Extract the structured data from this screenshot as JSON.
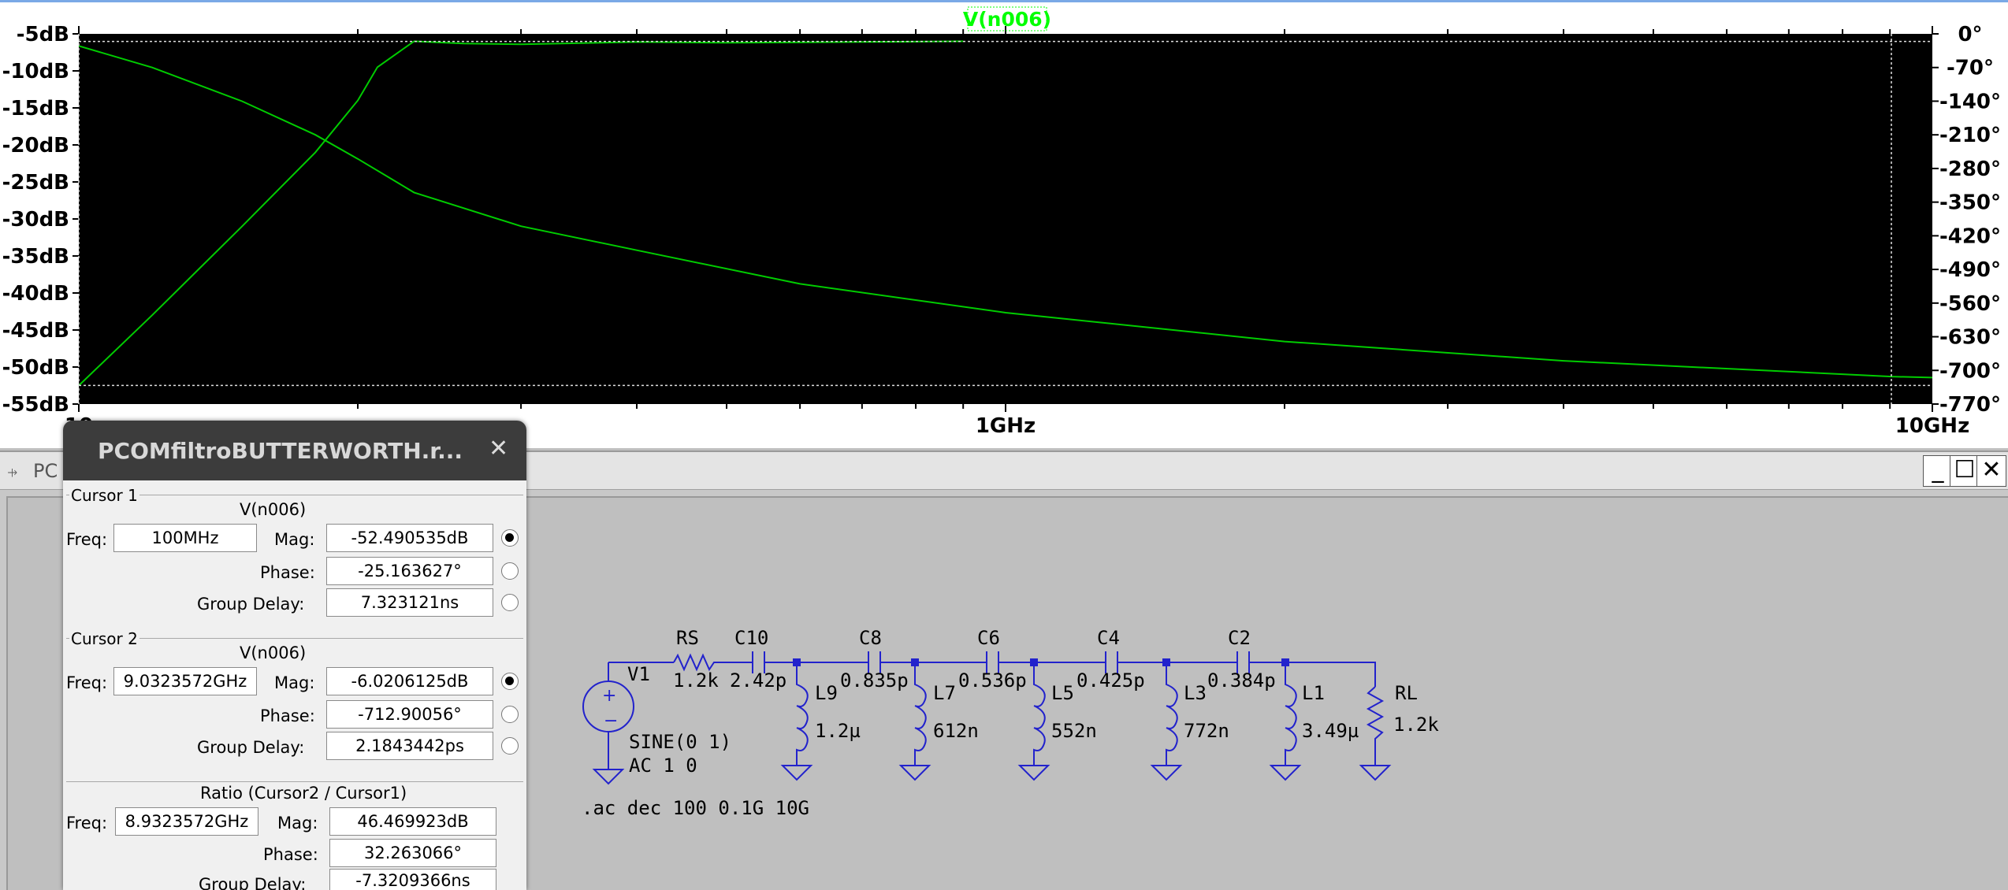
{
  "plot": {
    "trace_name": "V(n006)",
    "left_ticks": [
      "-5dB",
      "-10dB",
      "-15dB",
      "-20dB",
      "-25dB",
      "-30dB",
      "-35dB",
      "-40dB",
      "-45dB",
      "-50dB",
      "-55dB"
    ],
    "right_ticks": [
      "0°",
      "-70°",
      "-140°",
      "-210°",
      "-280°",
      "-350°",
      "-420°",
      "-490°",
      "-560°",
      "-630°",
      "-700°",
      "-770°"
    ],
    "x_ticks": [
      "100MHz",
      "1GHz",
      "10GHz"
    ],
    "x_tick_visible_left": "10",
    "colors": {
      "background": "#000000",
      "trace": "#00cc00",
      "label": "#00ff00"
    }
  },
  "chart_data": {
    "type": "line",
    "title": "V(n006)",
    "x_scale": "log",
    "xlim": [
      "100MHz",
      "10GHz"
    ],
    "ylim_left_dB": [
      -55,
      -5
    ],
    "ylim_right_deg": [
      -770,
      0
    ],
    "series": [
      {
        "name": "V(n006)",
        "style": "solid",
        "x": [
          "100MHz",
          "120MHz",
          "150MHz",
          "180MHz",
          "200MHz",
          "210MHz",
          "230MHz",
          "260MHz",
          "300MHz",
          "400MHz",
          "500MHz",
          "700MHz",
          "900MHz"
        ],
        "y": [
          -52.5,
          -43,
          -31,
          -21,
          -14,
          -9.5,
          -6,
          -6.3,
          -6.4,
          -6.1,
          -6.2,
          -6.1,
          -6.0
        ]
      },
      {
        "name": "Phase",
        "style": "dashed",
        "x": [
          "100MHz",
          "120MHz",
          "150MHz",
          "180MHz",
          "200MHz",
          "230MHz",
          "300MHz",
          "400MHz",
          "600MHz",
          "1GHz",
          "2GHz",
          "4GHz",
          "9.03GHz",
          "10GHz"
        ],
        "y": [
          -25,
          -70,
          -140,
          -210,
          -260,
          -330,
          -400,
          -450,
          -520,
          -580,
          -640,
          -680,
          -712.9,
          -715
        ]
      }
    ]
  },
  "dialog": {
    "title": "PCOMfiltroBUTTERWORTH.r...",
    "cursor1": {
      "group": "Cursor 1",
      "trace": "V(n006)",
      "freq_label": "Freq:",
      "freq": "100MHz",
      "mag_label": "Mag:",
      "mag": "-52.490535dB",
      "phase_label": "Phase:",
      "phase": "-25.163627°",
      "gd_label": "Group Delay:",
      "gd": "7.323121ns"
    },
    "cursor2": {
      "group": "Cursor 2",
      "trace": "V(n006)",
      "freq_label": "Freq:",
      "freq": "9.0323572GHz",
      "mag_label": "Mag:",
      "mag": "-6.0206125dB",
      "phase_label": "Phase:",
      "phase": "-712.90056°",
      "gd_label": "Group Delay:",
      "gd": "2.1843442ps"
    },
    "ratio": {
      "group": "Ratio (Cursor2 / Cursor1)",
      "freq_label": "Freq:",
      "freq": "8.9323572GHz",
      "mag_label": "Mag:",
      "mag": "46.469923dB",
      "phase_label": "Phase:",
      "phase": "32.263066°",
      "gd_label": "Group Delay:",
      "gd": "-7.3209366ns"
    }
  },
  "schematic": {
    "window_title": "PC",
    "win_buttons": [
      "_",
      "☐",
      "✕"
    ],
    "source": {
      "name": "V1",
      "value1": "SINE(0 1)",
      "value2": "AC 1 0"
    },
    "rs": {
      "name": "RS",
      "value": "1.2k"
    },
    "rl": {
      "name": "RL",
      "value": "1.2k"
    },
    "capacitors": [
      {
        "name": "C10",
        "value": "2.42p"
      },
      {
        "name": "C8",
        "value": "0.835p"
      },
      {
        "name": "C6",
        "value": "0.536p"
      },
      {
        "name": "C4",
        "value": "0.425p"
      },
      {
        "name": "C2",
        "value": "0.384p"
      }
    ],
    "inductors": [
      {
        "name": "L9",
        "value": "1.2µ"
      },
      {
        "name": "L7",
        "value": "612n"
      },
      {
        "name": "L5",
        "value": "552n"
      },
      {
        "name": "L3",
        "value": "772n"
      },
      {
        "name": "L1",
        "value": "3.49µ"
      }
    ],
    "directive": ".ac dec 100 0.1G 10G",
    "colors": {
      "wire": "#2222cc",
      "background": "#bfbfbf"
    }
  }
}
